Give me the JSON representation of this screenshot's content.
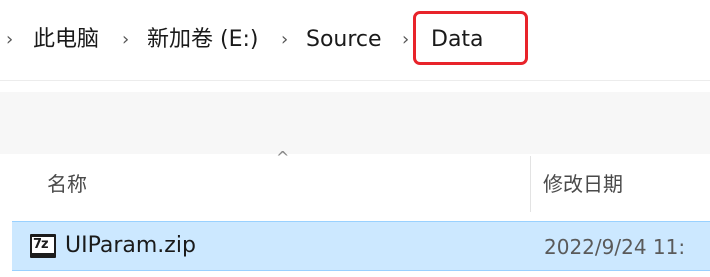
{
  "breadcrumb": {
    "lead_arrow": "›",
    "separator": "›",
    "items": [
      {
        "label": "此电脑"
      },
      {
        "label": "新加卷 (E:)"
      },
      {
        "label": "Source"
      },
      {
        "label": "Data"
      }
    ]
  },
  "annotation": {
    "color": "#e8232a",
    "target": "Data"
  },
  "columns": {
    "sort_indicator": "^",
    "name_header": "名称",
    "date_header": "修改日期"
  },
  "files": [
    {
      "icon": "7z-archive-icon",
      "icon_glyph": "7z",
      "name": "UIParam.zip",
      "modified": "2022/9/24 11:",
      "selected": true
    }
  ],
  "colors": {
    "selection_fill": "#cce8ff",
    "selection_border": "#99d1ff",
    "annotation_red": "#e8232a"
  }
}
